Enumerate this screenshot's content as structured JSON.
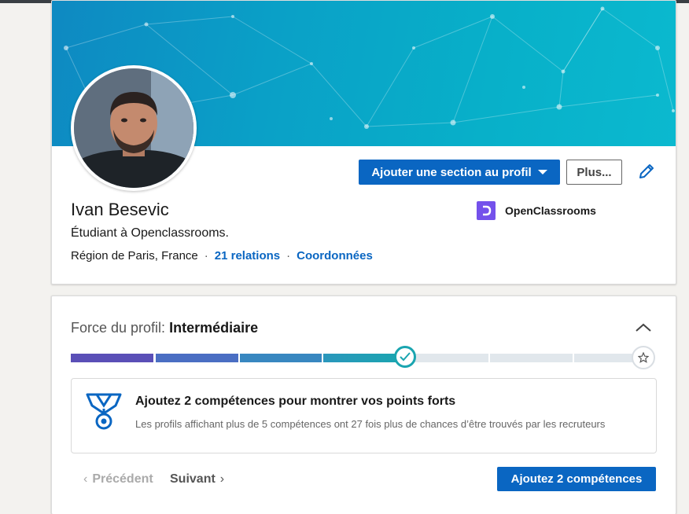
{
  "profile": {
    "name": "Ivan Besevic",
    "headline": "Étudiant à Openclassrooms.",
    "location": "Région de Paris, France",
    "separator": "·",
    "relations_link": "21 relations",
    "contact_link": "Coordonnées",
    "company_name": "OpenClassrooms",
    "company_logo_letter": "D",
    "add_section_label": "Ajouter une section au profil",
    "more_label": "Plus...",
    "edit_icon": "pencil-icon"
  },
  "strength": {
    "label": "Force du profil:",
    "level": "Intermédiaire",
    "progress_steps_total": 7,
    "progress_steps_completed": 4,
    "tip_title": "Ajoutez 2 compétences pour montrer vos points forts",
    "tip_body": "Les profils affichant plus de 5 compétences ont 27 fois plus de chances d’être trouvés par les recruteurs",
    "prev_label": "Précédent",
    "next_label": "Suivant",
    "cta_label": "Ajoutez 2 compétences",
    "prev_chevron": "‹",
    "next_chevron": "›"
  },
  "colors": {
    "accent": "#0a66c2",
    "company_logo": "#7451eb",
    "progress_start": "#5b4fb8",
    "progress_end": "#1aa5b0",
    "progress_empty": "#e1e7ec"
  }
}
